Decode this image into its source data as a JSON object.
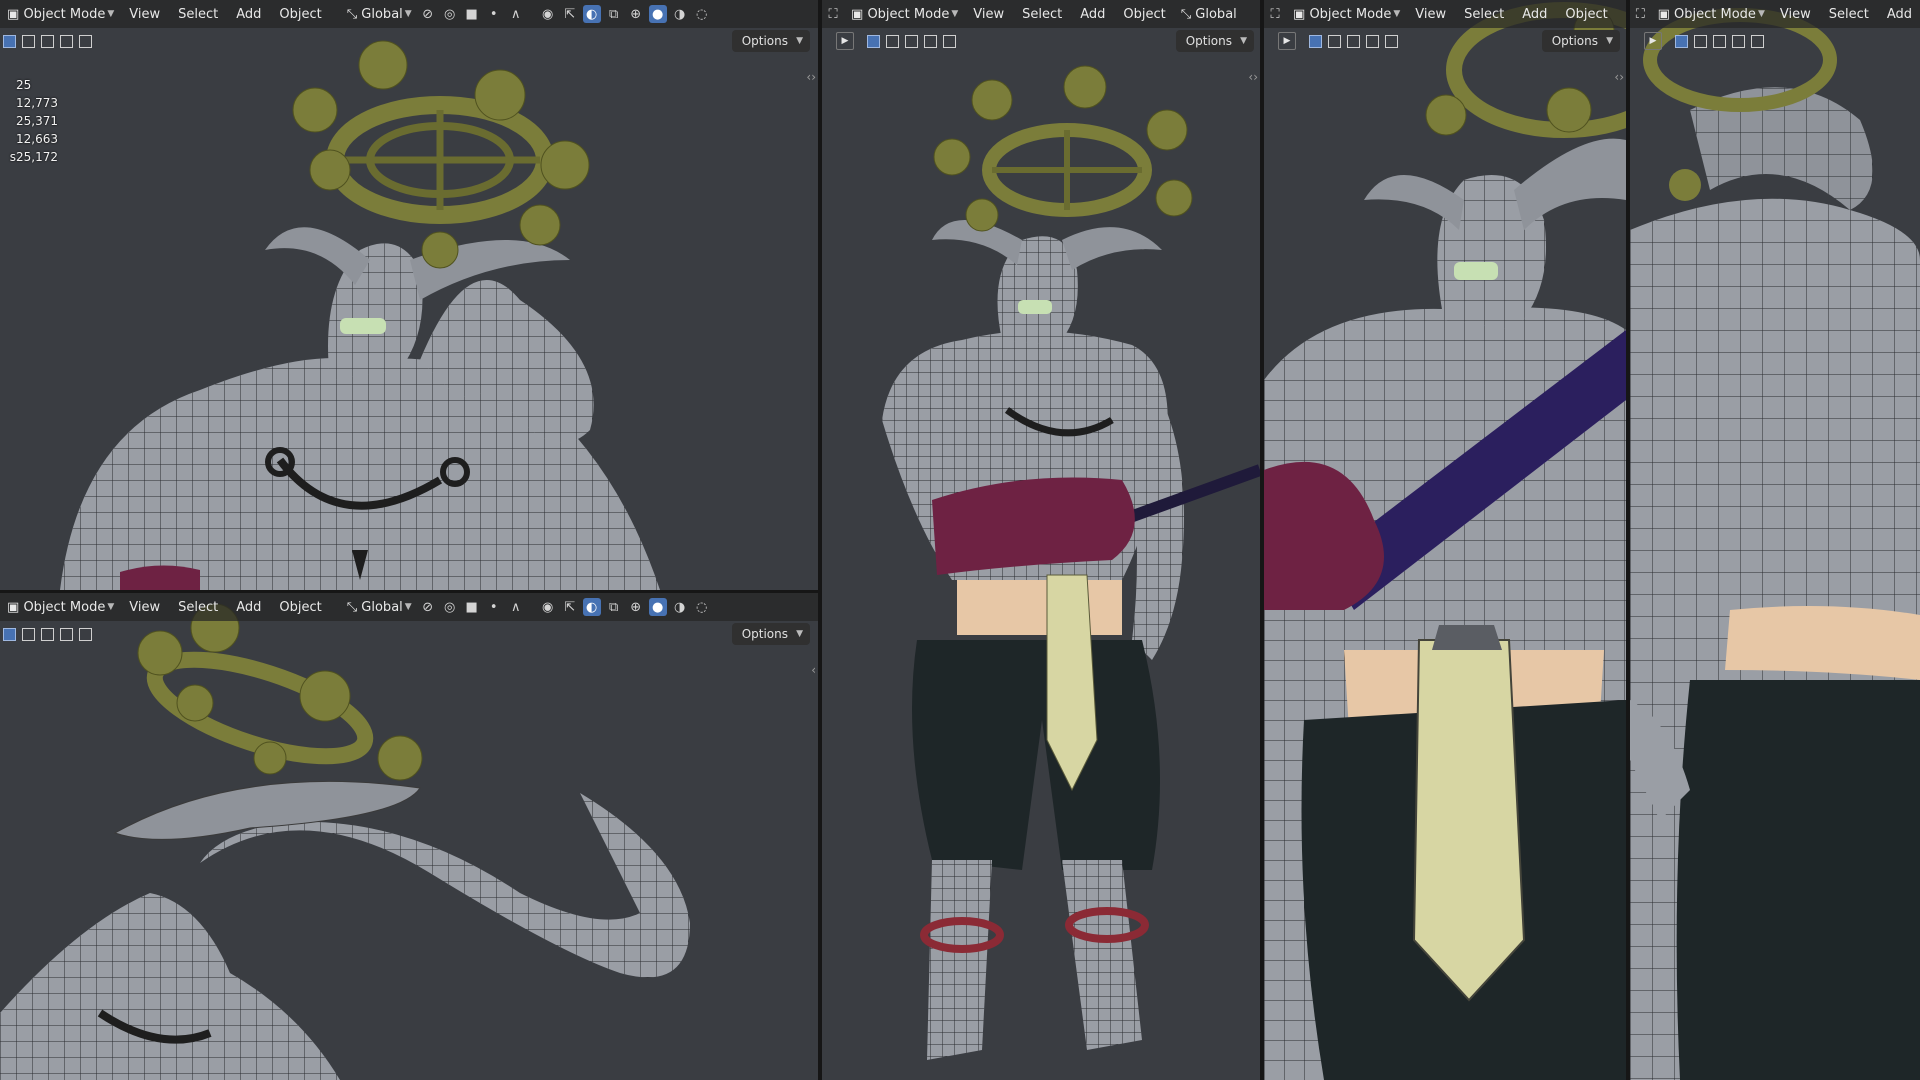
{
  "header": {
    "mode": "Object Mode",
    "menus": {
      "view": "View",
      "select": "Select",
      "add": "Add",
      "object": "Object"
    },
    "transform_orientation": "Global",
    "options_label": "Options"
  },
  "stats": [
    {
      "label": "",
      "value": "25"
    },
    {
      "label": "",
      "value": "12,773"
    },
    {
      "label": "",
      "value": "25,371"
    },
    {
      "label": "",
      "value": "12,663"
    },
    {
      "label": "s",
      "value": "25,172"
    }
  ],
  "colors": {
    "viewport_bg": "#3a3d42",
    "header_bg": "#262626",
    "accent": "#4772b3",
    "mesh_grey": "#9a9ea5",
    "wheel_olive": "#7b7d3a",
    "sleeve_maroon": "#6e2243",
    "belt_peach": "#e7c7a6",
    "loincloth": "#d7d6a3",
    "pants_dark": "#1e2628",
    "staff_indigo": "#2b1f5e",
    "teeth_green": "#c7e0b3"
  },
  "icons": [
    "object-mode-icon",
    "transform-icon",
    "snap-icon",
    "proportional-icon",
    "shading-solid-icon",
    "overlay-icon",
    "gizmo-icon",
    "xray-icon",
    "wireframe-icon",
    "material-icon",
    "rendered-icon"
  ]
}
